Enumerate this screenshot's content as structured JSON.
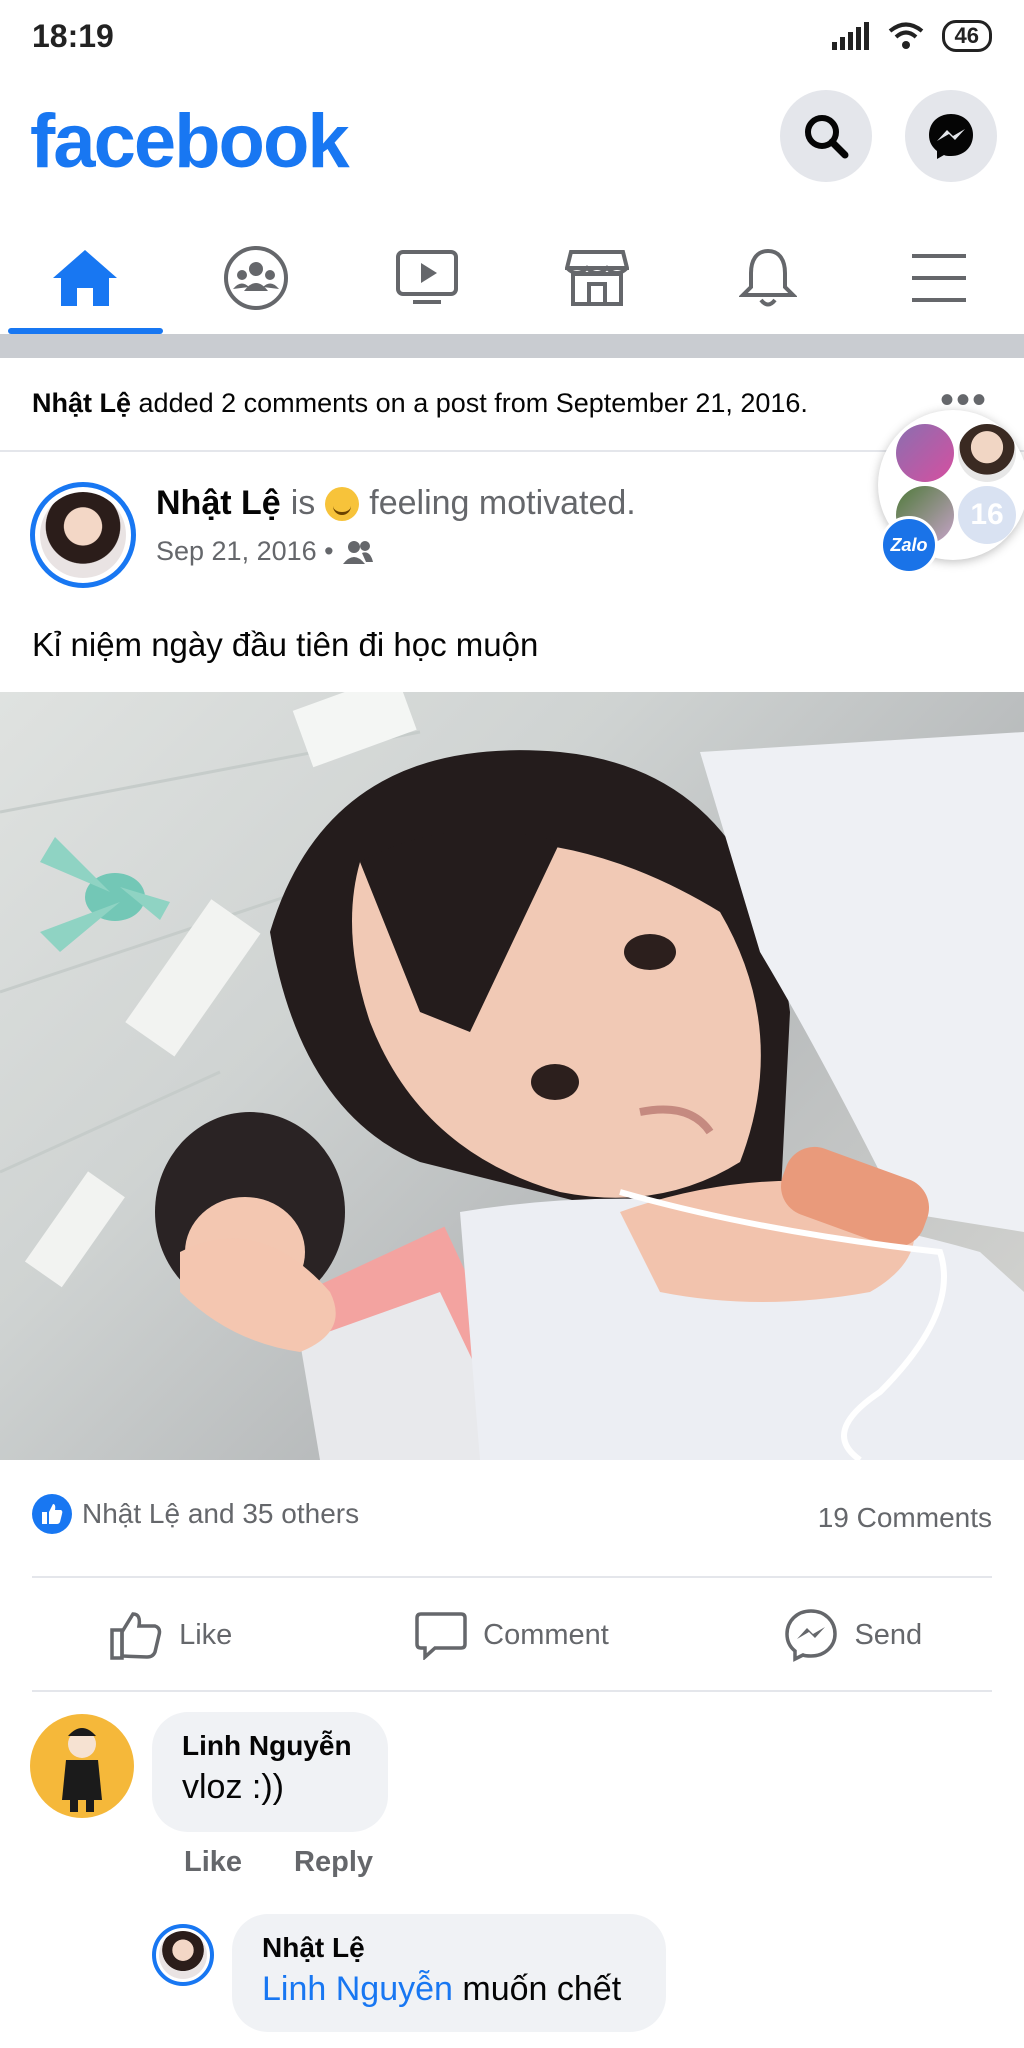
{
  "status_bar": {
    "time": "18:19",
    "battery": "46"
  },
  "header": {
    "logo": "facebook"
  },
  "tabs": [
    {
      "id": "home",
      "icon": "home-icon",
      "active": true
    },
    {
      "id": "groups",
      "icon": "groups-icon",
      "active": false
    },
    {
      "id": "watch",
      "icon": "watch-icon",
      "active": false
    },
    {
      "id": "marketplace",
      "icon": "marketplace-icon",
      "active": false
    },
    {
      "id": "notifications",
      "icon": "bell-icon",
      "active": false
    },
    {
      "id": "menu",
      "icon": "menu-icon",
      "active": false
    }
  ],
  "activity": {
    "actor": "Nhật Lệ",
    "text": "added 2 comments on a post from September 21, 2016.",
    "more": "•••"
  },
  "post": {
    "author": "Nhật Lệ",
    "is": "is",
    "feeling": "feeling motivated.",
    "date": "Sep 21, 2016 •",
    "text": "Kỉ niệm ngày đầu tiên đi học muộn",
    "reactions_text": "Nhật Lệ and 35 others",
    "comments_count": "19 Comments"
  },
  "actions": {
    "like": "Like",
    "comment": "Comment",
    "send": "Send"
  },
  "comments": [
    {
      "author": "Linh Nguyễn",
      "text": "vloz :))",
      "like_label": "Like",
      "reply_label": "Reply"
    }
  ],
  "reply": {
    "author": "Nhật Lệ",
    "mention": "Linh Nguyễn",
    "text": "muốn chết"
  },
  "floating_chat": {
    "count": "16",
    "badge": "Zalo"
  },
  "colors": {
    "brand": "#1877f2",
    "secondary_text": "#65676b",
    "bubble_bg": "#f0f2f5"
  }
}
